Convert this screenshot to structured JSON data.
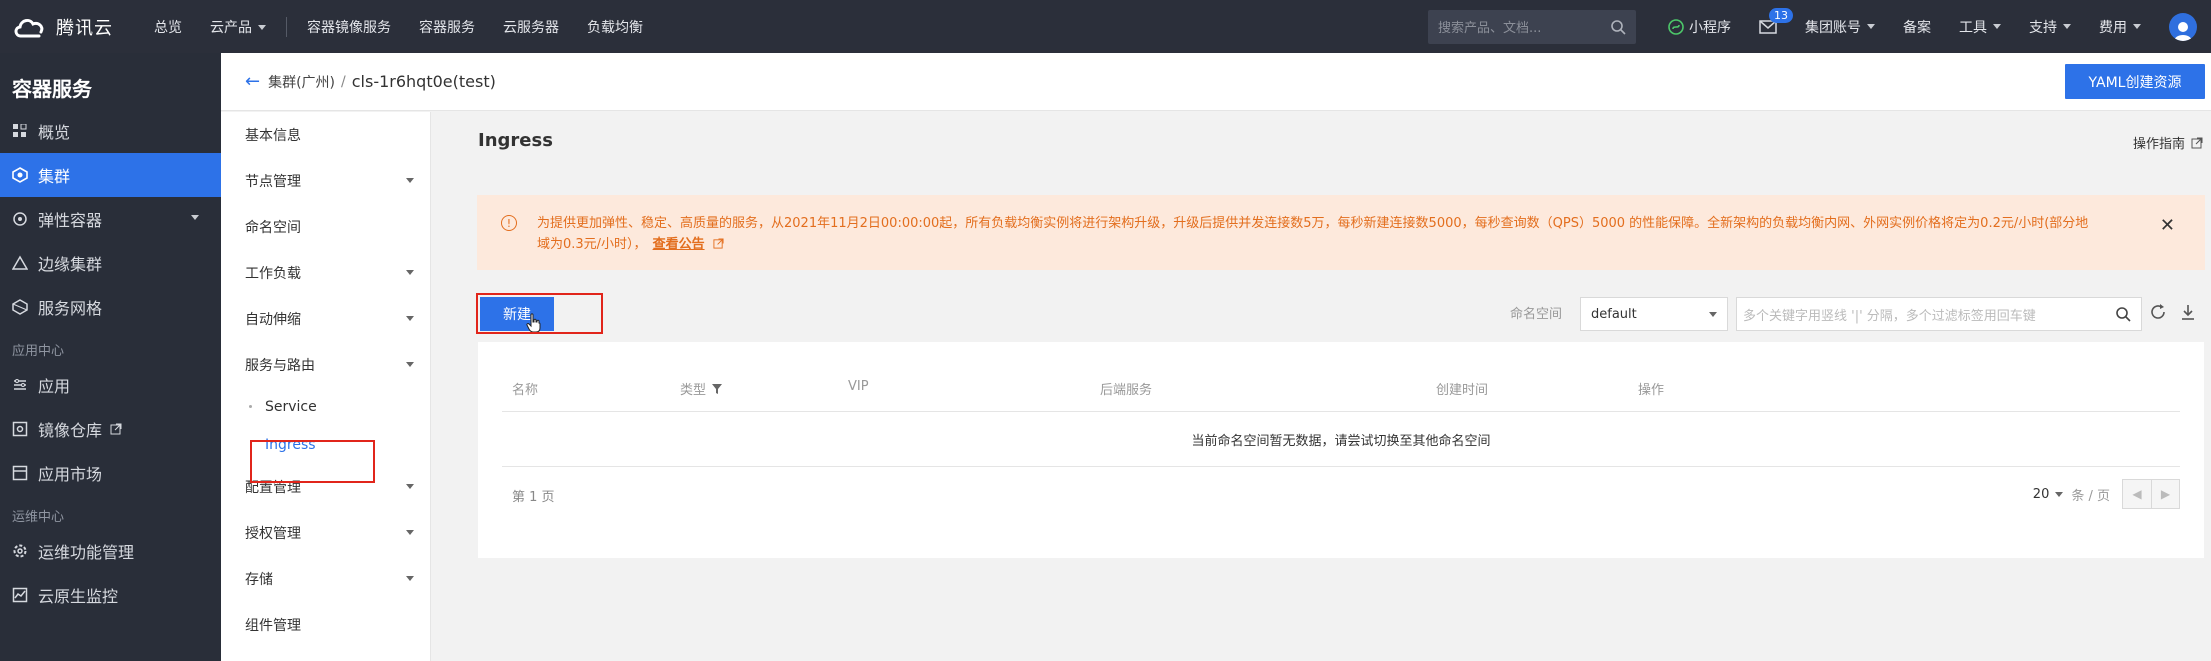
{
  "topnav": {
    "brand": "腾讯云",
    "items": [
      "总览",
      "云产品",
      "容器镜像服务",
      "容器服务",
      "云服务器",
      "负载均衡"
    ],
    "search_placeholder": "搜索产品、文档...",
    "right_items": {
      "miniprogram": "小程序",
      "mail_badge": "13",
      "account": "集团账号",
      "record": "备案",
      "tools": "工具",
      "support": "支持",
      "billing": "费用"
    }
  },
  "sidebar": {
    "title": "容器服务",
    "items": [
      {
        "label": "概览"
      },
      {
        "label": "集群"
      },
      {
        "label": "弹性容器"
      },
      {
        "label": "边缘集群"
      },
      {
        "label": "服务网格"
      }
    ],
    "section_app": "应用中心",
    "app_items": [
      {
        "label": "应用"
      },
      {
        "label": "镜像仓库"
      },
      {
        "label": "应用市场"
      }
    ],
    "section_ops": "运维中心",
    "ops_items": [
      {
        "label": "运维功能管理"
      },
      {
        "label": "云原生监控"
      }
    ]
  },
  "breadcrumb": {
    "parent": "集群(广州)",
    "sep": "/",
    "current": "cls-1r6hqt0e(test)",
    "yaml_button": "YAML创建资源"
  },
  "subnav": {
    "items": [
      "基本信息",
      "节点管理",
      "命名空间",
      "工作负载",
      "自动伸缩",
      "服务与路由"
    ],
    "sub_items": [
      "Service",
      "Ingress"
    ],
    "items_after": [
      "配置管理",
      "授权管理",
      "存储",
      "组件管理"
    ]
  },
  "main": {
    "title": "Ingress",
    "guide_link": "操作指南",
    "notice_text": "为提供更加弹性、稳定、高质量的服务，从2021年11月2日00:00:00起，所有负载均衡实例将进行架构升级，升级后提供并发连接数5万，每秒新建连接数5000，每秒查询数（QPS）5000 的性能保障。全新架构的负载均衡内网、外网实例价格将定为0.2元/小时(部分地域为0.3元/小时），",
    "notice_link": "查看公告",
    "new_button": "新建",
    "namespace_label": "命名空间",
    "namespace_value": "default",
    "filter_placeholder": "多个关键字用竖线 '|' 分隔，多个过滤标签用回车键",
    "columns": [
      "名称",
      "类型",
      "VIP",
      "后端服务",
      "创建时间",
      "操作"
    ],
    "empty_text": "当前命名空间暂无数据，请尝试切换至其他命名空间",
    "page_label": "第 1 页",
    "page_size": "20",
    "page_size_unit": "条 / 页"
  },
  "colors": {
    "accent": "#2d72e8",
    "topnav_bg": "#2b2f3a",
    "sidebar_bg": "#292e39",
    "notice_bg": "#fde9dc",
    "notice_text": "#e36e1e",
    "highlight_box": "#e1251b"
  }
}
